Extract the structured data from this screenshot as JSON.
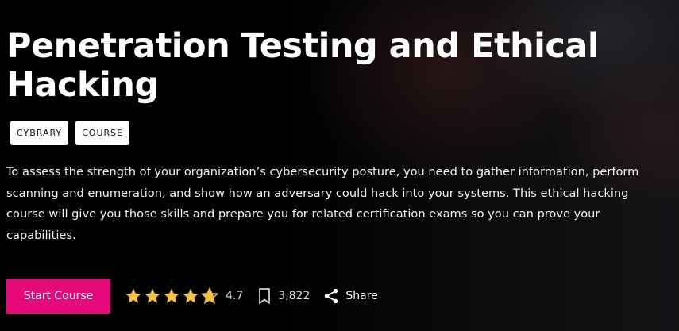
{
  "course": {
    "title": "Penetration Testing and Ethical Hacking",
    "tags": [
      "CYBRARY",
      "COURSE"
    ],
    "description": "To assess the strength of your organization’s cybersecurity posture, you need to gather information, perform scanning and enumeration, and show how an adversary could hack into your systems. This ethical hacking course will give you those skills and prepare you for related certification exams so you can prove your capabilities."
  },
  "actions": {
    "start_label": "Start Course",
    "rating": "4.7",
    "rating_value": 4.7,
    "rating_max": 5,
    "bookmark_count": "3,822",
    "share_label": "Share"
  },
  "colors": {
    "accent": "#e6097a",
    "star": "#f4c24b"
  },
  "icons": {
    "star": "star-icon",
    "bookmark": "bookmark-icon",
    "share": "share-icon"
  }
}
